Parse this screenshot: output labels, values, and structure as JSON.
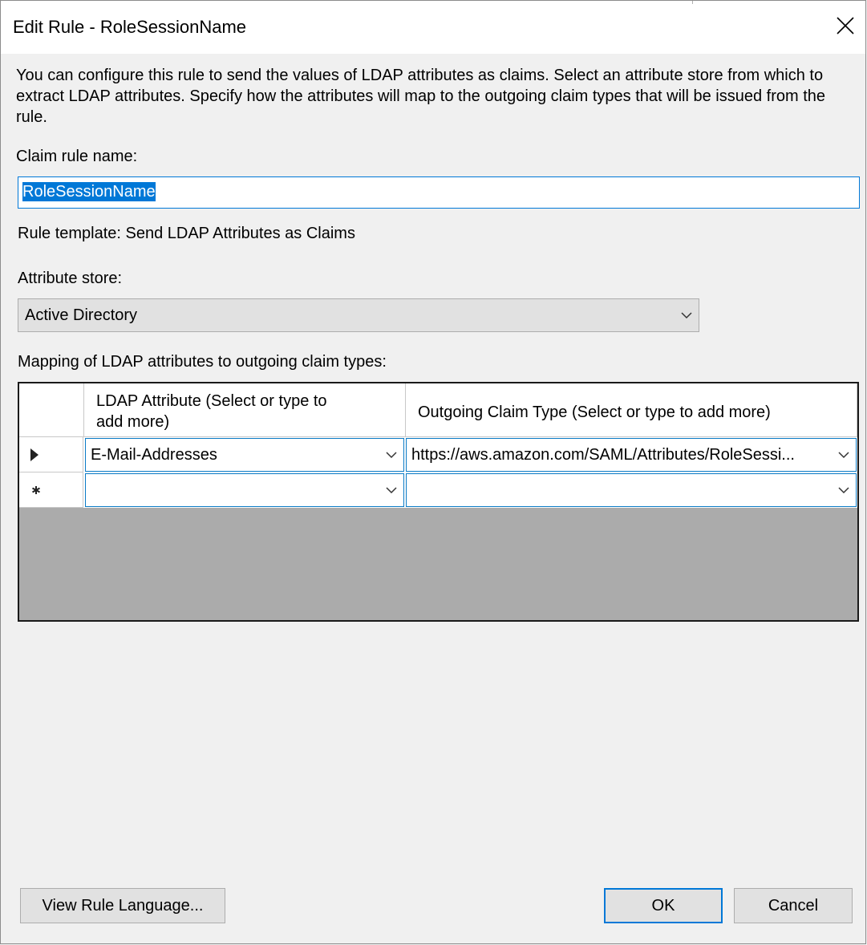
{
  "window": {
    "title": "Edit Rule - RoleSessionName",
    "close_icon": "close-icon"
  },
  "description": "You can configure this rule to send the values of LDAP attributes as claims. Select an attribute store from which to extract LDAP attributes. Specify how the attributes will map to the outgoing claim types that will be issued from the rule.",
  "claim_rule_name": {
    "label": "Claim rule name:",
    "value": "RoleSessionName"
  },
  "rule_template": "Rule template: Send LDAP Attributes as Claims",
  "attribute_store": {
    "label": "Attribute store:",
    "selected": "Active Directory",
    "icon": "chevron-down-icon"
  },
  "mapping": {
    "label": "Mapping of LDAP attributes to outgoing claim types:",
    "columns": {
      "ldap_line1": "LDAP Attribute (Select or type to",
      "ldap_line2": "add more)",
      "claim": "Outgoing Claim Type (Select or type to add more)"
    },
    "rows": [
      {
        "indicator": "current-row-arrow-icon",
        "ldap_attribute": "E-Mail-Addresses",
        "claim_type": "https://aws.amazon.com/SAML/Attributes/RoleSessi..."
      },
      {
        "indicator": "new-row-asterisk-icon",
        "ldap_attribute": "",
        "claim_type": ""
      }
    ],
    "empty_area_color": "#ababab"
  },
  "buttons": {
    "view_rule_language": "View Rule Language...",
    "ok": "OK",
    "cancel": "Cancel"
  },
  "colors": {
    "accent": "#0078d7",
    "dialog_bg": "#f0f0f0",
    "button_bg": "#e1e1e1"
  }
}
